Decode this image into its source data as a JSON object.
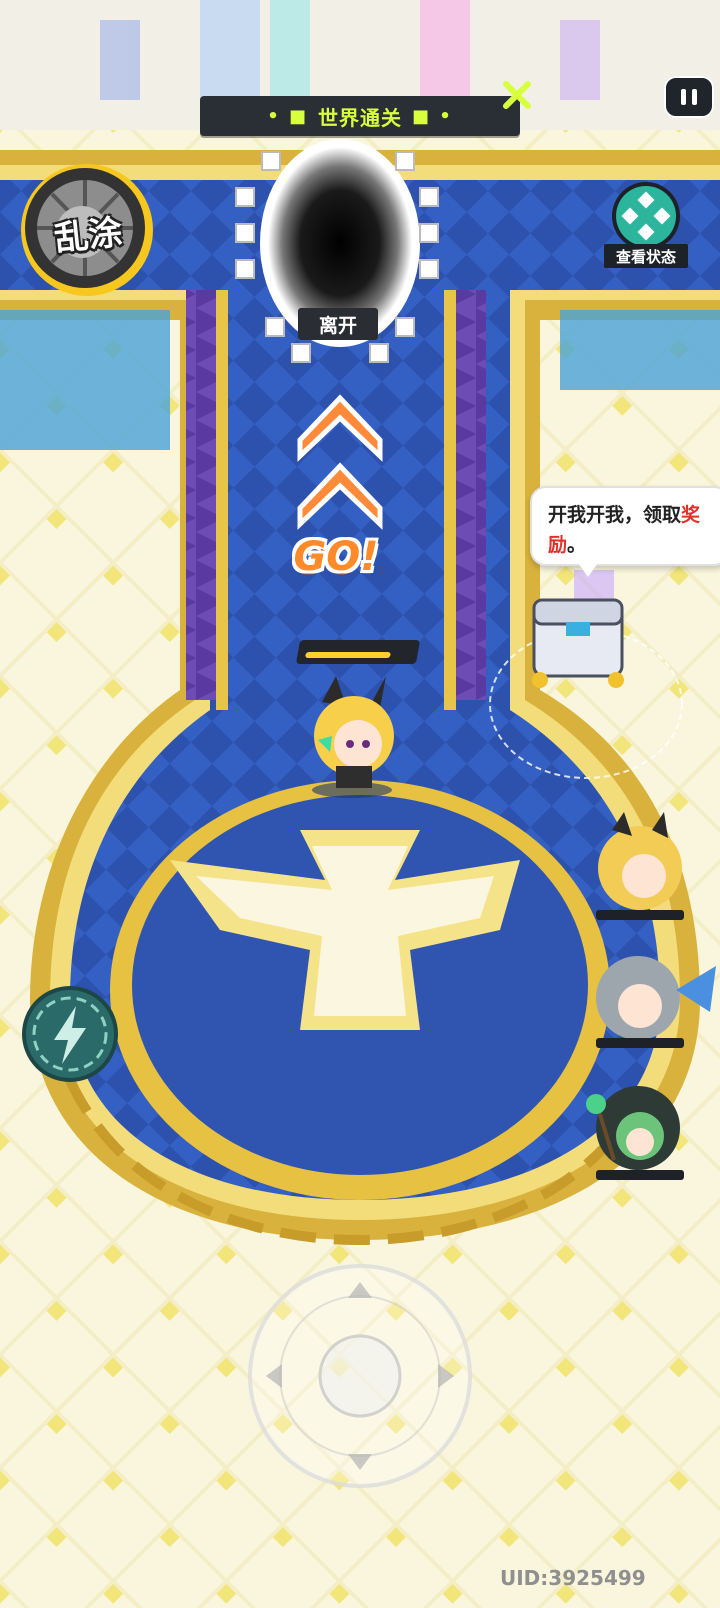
{
  "banner": {
    "title": "世界通关",
    "left_dots": "• ■",
    "right_dots": "■ •"
  },
  "graffiti_button": {
    "label": "乱涂"
  },
  "status_button": {
    "label": "查看状态"
  },
  "portal": {
    "label": "离开"
  },
  "bubble": {
    "text": "开我开我，领取",
    "highlight_a": "奖",
    "highlight_b": "励",
    "tail": "。"
  },
  "go_indicator": {
    "label": "GO!"
  },
  "hero": {
    "hp_fraction": 0.82
  },
  "party": [
    {
      "name": "party-member-1",
      "hp_fraction": 1.0
    },
    {
      "name": "party-member-2",
      "hp_fraction": 1.0
    },
    {
      "name": "party-member-3",
      "hp_fraction": 1.0
    }
  ],
  "footer": {
    "uid": "UID:3925499"
  },
  "colors": {
    "accent_lime": "#d7ff3e",
    "arena_blue": "#2f55b1",
    "gold": "#e9c64a",
    "go_orange": "#ff8a2a"
  },
  "icons": {
    "banner_close": "x-icon",
    "pause": "pause-icon",
    "status": "diamond-grid-icon",
    "energy": "lightning-icon",
    "joystick": "joystick-icon"
  }
}
